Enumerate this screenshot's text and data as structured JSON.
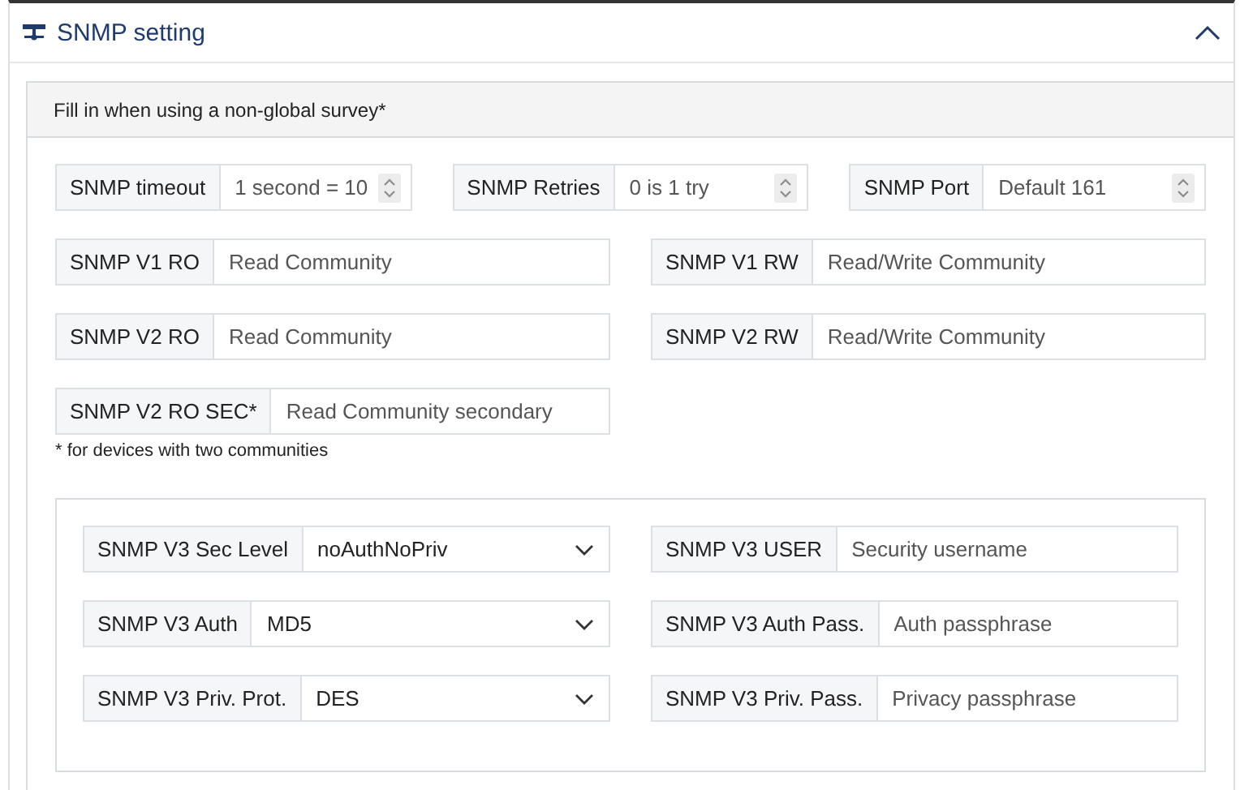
{
  "panel": {
    "title": "SNMP setting",
    "expanded": true
  },
  "card": {
    "header": "Fill in when using a non-global survey*",
    "rows": [
      {
        "fields": [
          {
            "kind": "number",
            "label": "SNMP timeout",
            "placeholder": "1 second = 10"
          },
          {
            "kind": "number",
            "label": "SNMP Retries",
            "placeholder": "0 is 1 try"
          },
          {
            "kind": "number",
            "label": "SNMP Port",
            "placeholder": "Default 161"
          }
        ]
      },
      {
        "fields": [
          {
            "kind": "text",
            "label": "SNMP V1 RO",
            "placeholder": "Read Community"
          },
          {
            "kind": "text",
            "label": "SNMP V1 RW",
            "placeholder": "Read/Write Community"
          }
        ]
      },
      {
        "fields": [
          {
            "kind": "text",
            "label": "SNMP V2 RO",
            "placeholder": "Read Community"
          },
          {
            "kind": "text",
            "label": "SNMP V2 RW",
            "placeholder": "Read/Write Community"
          }
        ]
      },
      {
        "fields": [
          {
            "kind": "text",
            "label": "SNMP V2 RO SEC*",
            "placeholder": "Read Community secondary"
          }
        ]
      }
    ],
    "note": "* for devices with two communities",
    "v3_rows": [
      {
        "fields": [
          {
            "kind": "select",
            "label": "SNMP V3 Sec Level",
            "value": "noAuthNoPriv"
          },
          {
            "kind": "text",
            "label": "SNMP V3 USER",
            "placeholder": "Security username"
          }
        ]
      },
      {
        "fields": [
          {
            "kind": "select",
            "label": "SNMP V3 Auth",
            "value": "MD5"
          },
          {
            "kind": "text",
            "label": "SNMP V3 Auth Pass.",
            "placeholder": "Auth passphrase"
          }
        ]
      },
      {
        "fields": [
          {
            "kind": "select",
            "label": "SNMP V3 Priv. Prot.",
            "value": "DES"
          },
          {
            "kind": "text",
            "label": "SNMP V3 Priv. Pass.",
            "placeholder": "Privacy passphrase"
          }
        ]
      }
    ]
  }
}
